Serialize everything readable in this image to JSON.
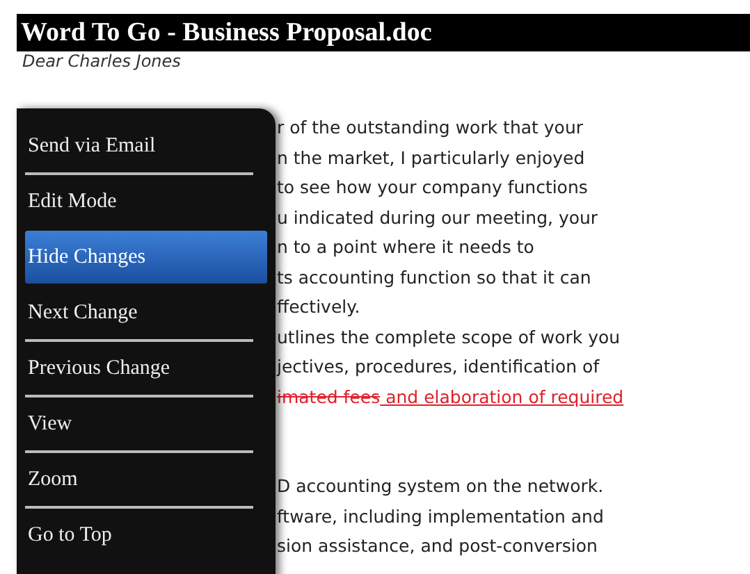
{
  "window": {
    "title": "Word To Go - Business Proposal.doc"
  },
  "document": {
    "salutation": "Dear Charles Jones",
    "paragraphs": [
      {
        "lines": [
          [
            {
              "kind": "normal",
              "text": "r of the outstanding work that your"
            }
          ],
          [
            {
              "kind": "normal",
              "text": "n the market, I particularly enjoyed"
            }
          ],
          [
            {
              "kind": "normal",
              "text": "to see how your company functions"
            }
          ],
          [
            {
              "kind": "normal",
              "text": "u indicated during our meeting, your"
            }
          ],
          [
            {
              "kind": "normal",
              "text": "n to a point where it needs to"
            }
          ],
          [
            {
              "kind": "normal",
              "text": "ts accounting function so that it can"
            }
          ],
          [
            {
              "kind": "normal",
              "text": "ffectively."
            }
          ],
          [
            {
              "kind": "normal",
              "text": "utlines the complete scope of work you"
            }
          ],
          [
            {
              "kind": "normal",
              "text": "jectives, procedures, identification of"
            }
          ],
          [
            {
              "kind": "deleted",
              "text": "imated fees"
            },
            {
              "kind": "inserted",
              "text": " and elaboration of required"
            }
          ]
        ]
      },
      {
        "lines": [
          [
            {
              "kind": "normal",
              "text": "D accounting system on the network."
            }
          ],
          [
            {
              "kind": "normal",
              "text": "ftware, including implementation and"
            }
          ],
          [
            {
              "kind": "normal",
              "text": "sion assistance, and post-conversion"
            }
          ]
        ]
      }
    ]
  },
  "menu": {
    "items": [
      {
        "label": "Send via Email",
        "selected": false
      },
      {
        "label": "Edit Mode",
        "selected": false
      },
      {
        "label": "Hide Changes",
        "selected": true
      },
      {
        "label": "Next Change",
        "selected": false
      },
      {
        "label": "Previous Change",
        "selected": false
      },
      {
        "label": "View",
        "selected": false
      },
      {
        "label": "Zoom",
        "selected": false
      },
      {
        "label": "Go to Top",
        "selected": false
      }
    ]
  }
}
